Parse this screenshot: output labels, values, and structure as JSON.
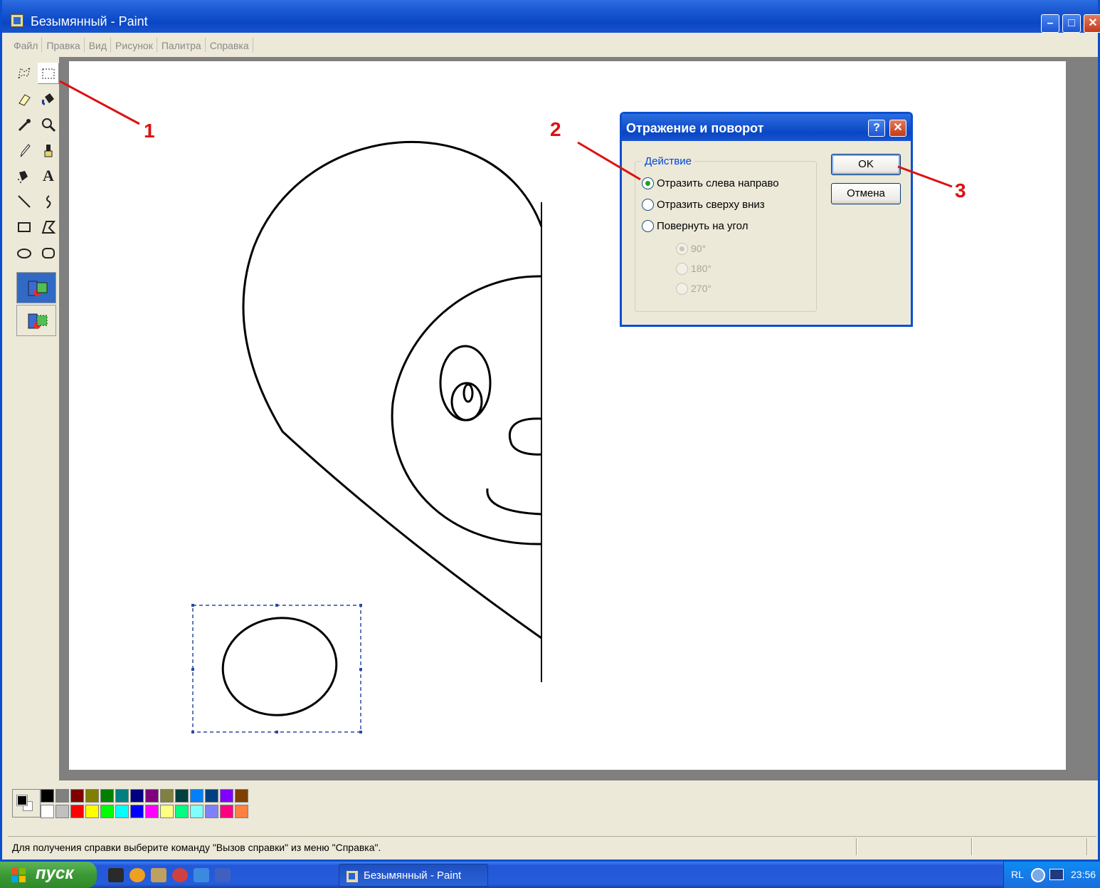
{
  "window": {
    "title": "Безымянный - Paint"
  },
  "menu": {
    "items": [
      "Файл",
      "Правка",
      "Вид",
      "Рисунок",
      "Палитра",
      "Справка"
    ]
  },
  "toolbox": {
    "tools": [
      "free-select-icon",
      "rect-select-icon",
      "eraser-icon",
      "fill-icon",
      "color-picker-icon",
      "magnifier-icon",
      "pencil-icon",
      "brush-icon",
      "airbrush-icon",
      "text-icon",
      "line-icon",
      "curve-icon",
      "rectangle-icon",
      "polygon-icon",
      "ellipse-icon",
      "rounded-rect-icon"
    ],
    "text_tool_label": "A"
  },
  "palette": {
    "top_row": [
      "#000000",
      "#808080",
      "#800000",
      "#808000",
      "#008000",
      "#008080",
      "#000080",
      "#800080",
      "#808040",
      "#004040",
      "#0080ff",
      "#004080",
      "#8000ff",
      "#804000"
    ],
    "bottom_row": [
      "#ffffff",
      "#c0c0c0",
      "#ff0000",
      "#ffff00",
      "#00ff00",
      "#00ffff",
      "#0000ff",
      "#ff00ff",
      "#ffff80",
      "#00ff80",
      "#80ffff",
      "#8080ff",
      "#ff0080",
      "#ff8040"
    ]
  },
  "status": {
    "text": "Для получения справки выберите команду \"Вызов справки\" из меню \"Справка\"."
  },
  "dialog": {
    "title": "Отражение и поворот",
    "help_label": "?",
    "close_label": "✕",
    "group_label": "Действие",
    "options": [
      "Отразить слева направо",
      "Отразить сверху вниз",
      "Повернуть на угол"
    ],
    "angles": [
      "90°",
      "180°",
      "270°"
    ],
    "ok_label": "OK",
    "cancel_label": "Отмена"
  },
  "annotations": [
    "1",
    "2",
    "3"
  ],
  "taskbar": {
    "start_label": "пуск",
    "task_label": "Безымянный - Paint",
    "lang": "RL",
    "clock": "23:56"
  }
}
